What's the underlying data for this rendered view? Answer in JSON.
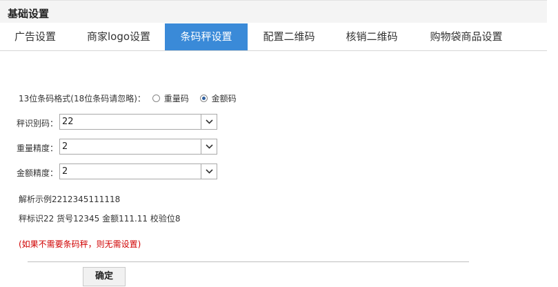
{
  "header": {
    "title": "基础设置"
  },
  "tabs": [
    {
      "label": "广告设置"
    },
    {
      "label": "商家logo设置"
    },
    {
      "label": "条码秤设置"
    },
    {
      "label": "配置二维码"
    },
    {
      "label": "核销二维码"
    },
    {
      "label": "购物袋商品设置"
    }
  ],
  "active_tab": "条码秤设置",
  "format": {
    "label": "13位条码格式(18位条码请忽略)",
    "options": [
      {
        "label": "重量码",
        "checked": false
      },
      {
        "label": "金额码",
        "checked": true
      }
    ]
  },
  "fields": [
    {
      "label": "秤识别码",
      "value": "22"
    },
    {
      "label": "重量精度",
      "value": "2"
    },
    {
      "label": "金额精度",
      "value": "2"
    }
  ],
  "example": {
    "line1": "解析示例2212345111118",
    "line2": "秤标识22 货号12345 金额111.11 校验位8"
  },
  "note": "(如果不需要条码秤，则无需设置)",
  "submit_label": "确定",
  "colors": {
    "tab_active": "#3a8ad8",
    "note": "#d00000"
  }
}
